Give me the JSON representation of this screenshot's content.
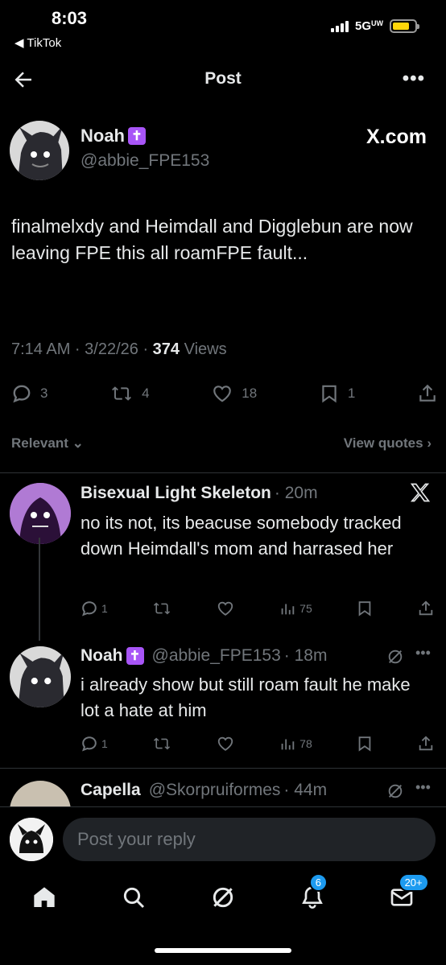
{
  "status": {
    "time": "8:03",
    "back_app": "◀ TikTok",
    "network": "5G",
    "network_sup": "UW"
  },
  "header": {
    "title": "Post",
    "more_icon": "more-icon"
  },
  "post": {
    "name": "Noah",
    "name_emoji": "✝",
    "handle": "@abbie_FPE153",
    "source": "X.com",
    "text": "finalmelxdy and Heimdall and Digglebun are now leaving FPE this all roamFPE fault...",
    "time": "7:14 AM · 3/22/26 · ",
    "views_count": "374",
    "views_label": " Views",
    "replies": "3",
    "reposts": "4",
    "likes": "18",
    "bookmarks": "1"
  },
  "filters": {
    "relevant": "Relevant",
    "view_quotes": "View quotes"
  },
  "replies": [
    {
      "name": "Bisexual Light Skeleton",
      "meta": "· 20m",
      "text": "no its not, its beacuse somebody tracked down Heimdall's mom and harrased her",
      "replies": "1",
      "reposts": "",
      "likes": "",
      "views": "75"
    },
    {
      "name": "Noah",
      "name_emoji": "✝",
      "handle": "@abbie_FPE153",
      "meta": "· 18m",
      "text": "i already show but still roam fault he make lot a hate at him",
      "replies": "1",
      "reposts": "",
      "likes": "",
      "views": "78"
    },
    {
      "name": "Capella",
      "handle": "@Skorpruiformes",
      "meta": "· 44m"
    }
  ],
  "composer": {
    "placeholder": "Post your reply"
  },
  "tabs": {
    "notifications_badge": "6",
    "messages_badge": "20+"
  },
  "colors": {
    "accent": "#1d9bf0",
    "muted": "#71767b",
    "badge_purple": "#a855f7"
  }
}
